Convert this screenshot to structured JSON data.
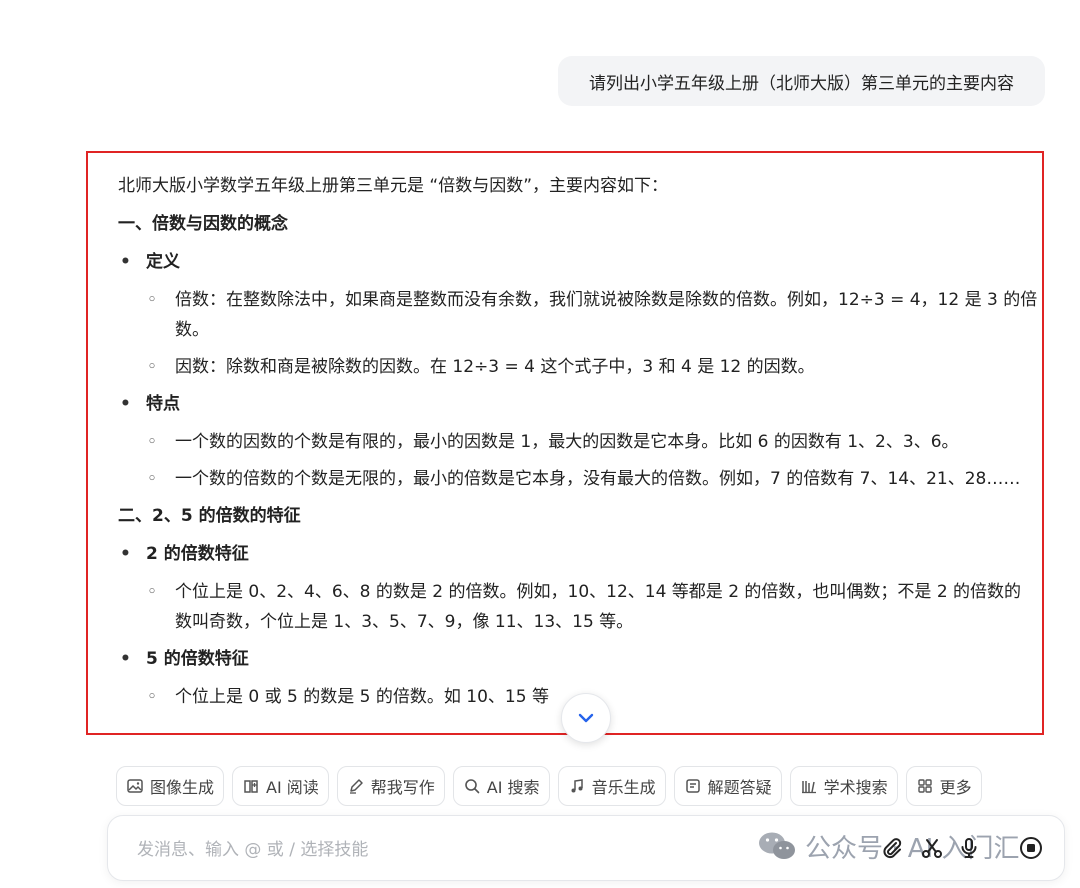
{
  "user_message": "请列出小学五年级上册（北师大版）第三单元的主要内容",
  "answer": {
    "intro": "北师大版小学数学五年级上册第三单元是 “倍数与因数”，主要内容如下：",
    "section1": {
      "heading": "一、倍数与因数的概念",
      "bullet1": {
        "title": "定义",
        "items": [
          "倍数：在整数除法中，如果商是整数而没有余数，我们就说被除数是除数的倍数。例如，12÷3 = 4，12 是 3 的倍数。",
          "因数：除数和商是被除数的因数。在 12÷3 = 4 这个式子中，3 和 4 是 12 的因数。"
        ]
      },
      "bullet2": {
        "title": "特点",
        "items": [
          "一个数的因数的个数是有限的，最小的因数是 1，最大的因数是它本身。比如 6 的因数有 1、2、3、6。",
          "一个数的倍数的个数是无限的，最小的倍数是它本身，没有最大的倍数。例如，7 的倍数有 7、14、21、28……"
        ]
      }
    },
    "section2": {
      "heading": "二、2、5 的倍数的特征",
      "bullet1": {
        "title": "2 的倍数特征",
        "items": [
          "个位上是 0、2、4、6、8 的数是 2 的倍数。例如，10、12、14 等都是 2 的倍数，也叫偶数；不是 2 的倍数的数叫奇数，个位上是 1、3、5、7、9，像 11、13、15 等。"
        ]
      },
      "bullet2": {
        "title": "5 的倍数特征",
        "items": [
          "个位上是 0 或 5 的数是 5 的倍数。如 10、15 等"
        ]
      }
    }
  },
  "skills": [
    {
      "label": "图像生成",
      "icon": "image-icon"
    },
    {
      "label": "AI 阅读",
      "icon": "book-icon"
    },
    {
      "label": "帮我写作",
      "icon": "pen-icon"
    },
    {
      "label": "AI 搜索",
      "icon": "search-icon"
    },
    {
      "label": "音乐生成",
      "icon": "music-icon"
    },
    {
      "label": "解题答疑",
      "icon": "question-icon"
    },
    {
      "label": "学术搜索",
      "icon": "library-icon"
    },
    {
      "label": "更多",
      "icon": "grid-icon"
    }
  ],
  "composer": {
    "placeholder": "发消息、输入 @ 或 / 选择技能"
  },
  "watermark": "公众号 · AI 入门汇",
  "colors": {
    "highlight_border": "#e02424",
    "bubble_bg": "#f3f4f6"
  }
}
